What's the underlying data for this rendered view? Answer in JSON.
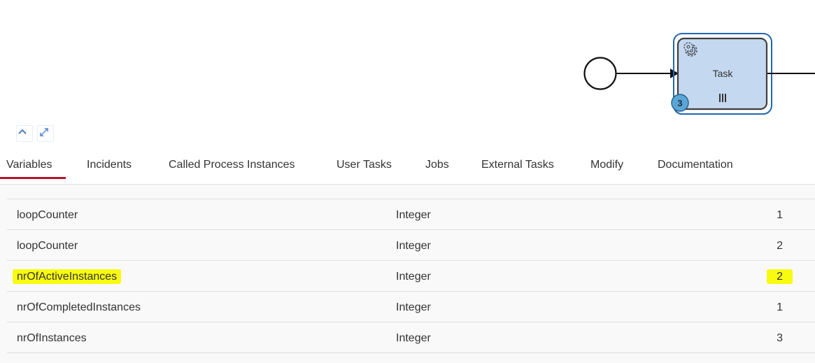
{
  "diagram": {
    "task_label": "Task",
    "instance_badge": "3",
    "icons": {
      "service_task": "gear-icon",
      "multi_instance": "parallel-marker-icon",
      "collapse": "chevron-up-icon",
      "fullscreen": "expand-icon"
    },
    "colors": {
      "task_fill": "#c4d8f0",
      "task_selection": "#1f66b5",
      "badge_fill": "#5aa7d6"
    }
  },
  "tabs": [
    {
      "label": "Variables",
      "active": true
    },
    {
      "label": "Incidents"
    },
    {
      "label": "Called Process Instances"
    },
    {
      "label": "User Tasks"
    },
    {
      "label": "Jobs"
    },
    {
      "label": "External Tasks"
    },
    {
      "label": "Modify"
    },
    {
      "label": "Documentation"
    }
  ],
  "variables": [
    {
      "name": "loopCounter",
      "type": "Integer",
      "value": "1"
    },
    {
      "name": "loopCounter",
      "type": "Integer",
      "value": "2"
    },
    {
      "name": "nrOfActiveInstances",
      "type": "Integer",
      "value": "2",
      "highlighted": true
    },
    {
      "name": "nrOfCompletedInstances",
      "type": "Integer",
      "value": "1"
    },
    {
      "name": "nrOfInstances",
      "type": "Integer",
      "value": "3"
    }
  ],
  "colors": {
    "active_tab_underline": "#b5152b",
    "highlight": "#f8fb0f"
  }
}
